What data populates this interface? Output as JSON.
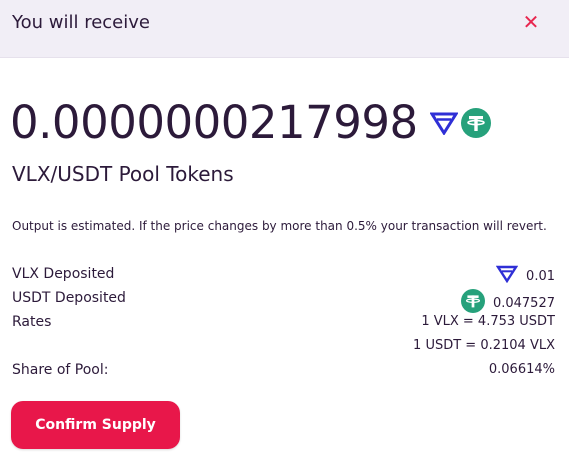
{
  "header": {
    "title": "You will receive",
    "close_icon": "close-icon"
  },
  "amount": {
    "value": "0.0000000217998",
    "token0_icon": "vlx-token-icon",
    "token1_icon": "usdt-token-icon"
  },
  "pool_label": "VLX/USDT Pool Tokens",
  "note": "Output is estimated. If the price changes by more than 0.5% your transaction will revert.",
  "details": {
    "vlx_deposited_label": "VLX Deposited",
    "vlx_deposited_value": "0.01",
    "usdt_deposited_label": "USDT Deposited",
    "usdt_deposited_value": "0.047527",
    "rates_label": "Rates",
    "rate_1": "1 VLX = 4.753 USDT",
    "rate_2": "1 USDT = 0.2104 VLX",
    "share_label": "Share of Pool:",
    "share_value": "0.06614%"
  },
  "confirm_button": "Confirm Supply",
  "colors": {
    "accent": "#e8174a",
    "header_bg": "#f1eef6",
    "vlx_blue": "#2f2fd6",
    "usdt_green": "#26a17b",
    "text": "#2c1a3a"
  }
}
